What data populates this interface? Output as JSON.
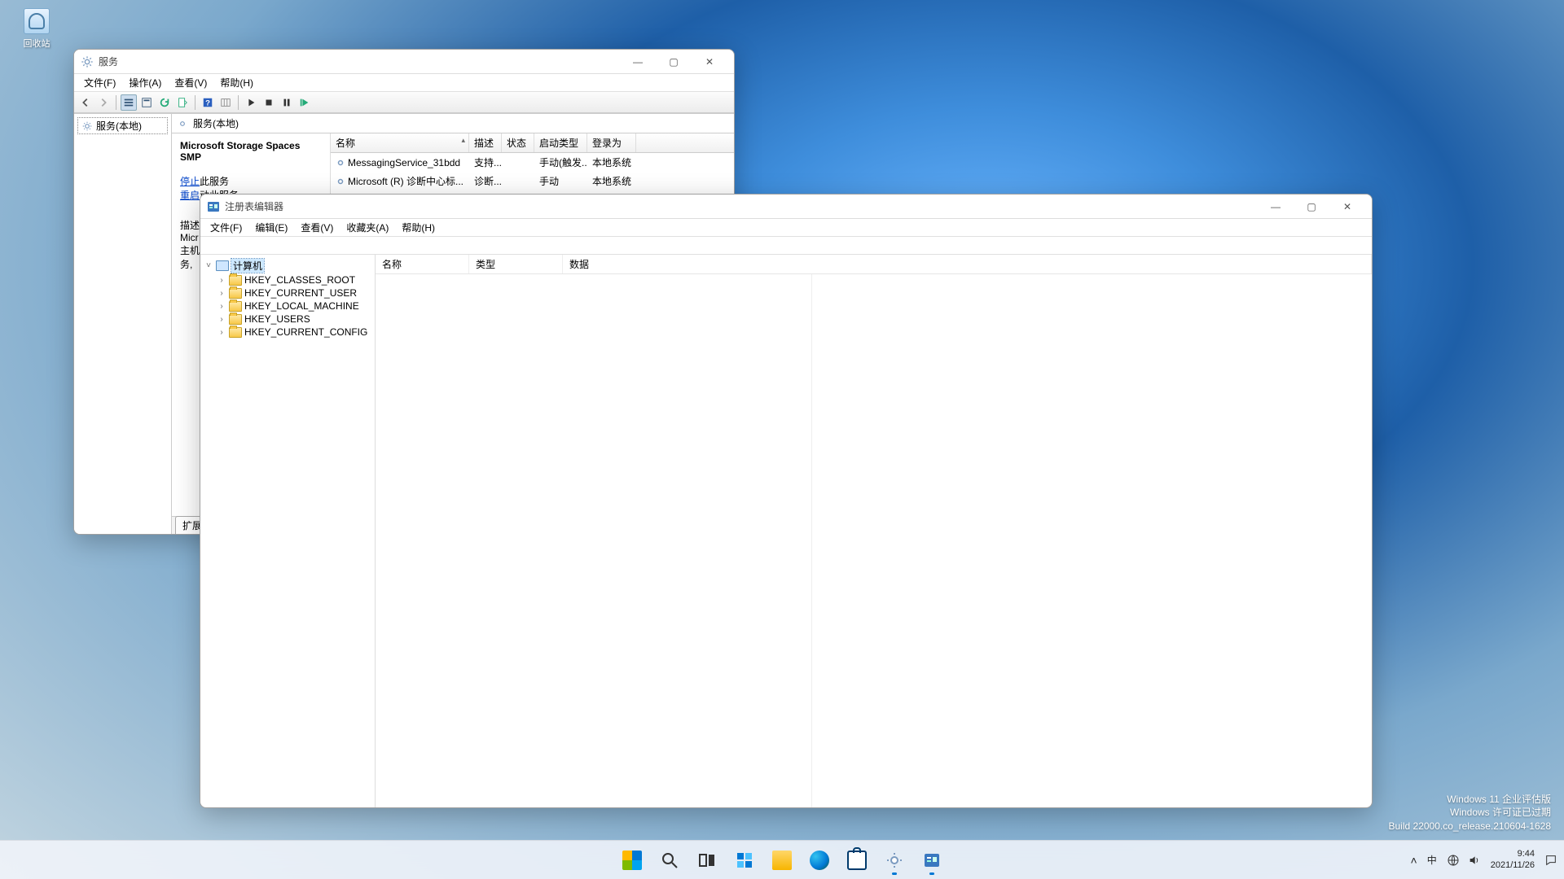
{
  "desktop": {
    "recycle_bin": "回收站"
  },
  "services_window": {
    "title": "服务",
    "menu": {
      "file": "文件(F)",
      "action": "操作(A)",
      "view": "查看(V)",
      "help": "帮助(H)"
    },
    "nav_item": "服务(本地)",
    "panel_header": "服务(本地)",
    "selected_service": "Microsoft Storage Spaces SMP",
    "action_links": {
      "stop": "停止",
      "stop_suffix": "此服务",
      "restart": "重启",
      "restart_suffix": "动此服务"
    },
    "desc_label": "描述",
    "desc_lines": [
      "Micr",
      "主机",
      "务,"
    ],
    "columns": {
      "name": "名称",
      "desc": "描述",
      "status": "状态",
      "startup": "启动类型",
      "logon": "登录为"
    },
    "rows": [
      {
        "name": "MessagingService_31bdd",
        "desc": "支持...",
        "status": "",
        "startup": "手动(触发...",
        "logon": "本地系统"
      },
      {
        "name": "Microsoft (R) 诊断中心标...",
        "desc": "诊断...",
        "status": "",
        "startup": "手动",
        "logon": "本地系统"
      }
    ],
    "tabs": {
      "extended": "扩展"
    }
  },
  "regedit_window": {
    "title": "注册表编辑器",
    "menu": {
      "file": "文件(F)",
      "edit": "编辑(E)",
      "view": "查看(V)",
      "fav": "收藏夹(A)",
      "help": "帮助(H)"
    },
    "tree": {
      "root": "计算机",
      "hives": [
        "HKEY_CLASSES_ROOT",
        "HKEY_CURRENT_USER",
        "HKEY_LOCAL_MACHINE",
        "HKEY_USERS",
        "HKEY_CURRENT_CONFIG"
      ]
    },
    "columns": {
      "name": "名称",
      "type": "类型",
      "data": "数据"
    }
  },
  "taskbar": {
    "tray": {
      "chevron": "˄",
      "ime": "中",
      "net": "net",
      "vol": "vol"
    },
    "clock": {
      "time": "9:44",
      "date": "2021/11/26"
    }
  },
  "watermark": {
    "l1": "Windows 11 企业评估版",
    "l2": "Windows 许可证已过期",
    "l3": "Build 22000.co_release.210604-1628"
  }
}
